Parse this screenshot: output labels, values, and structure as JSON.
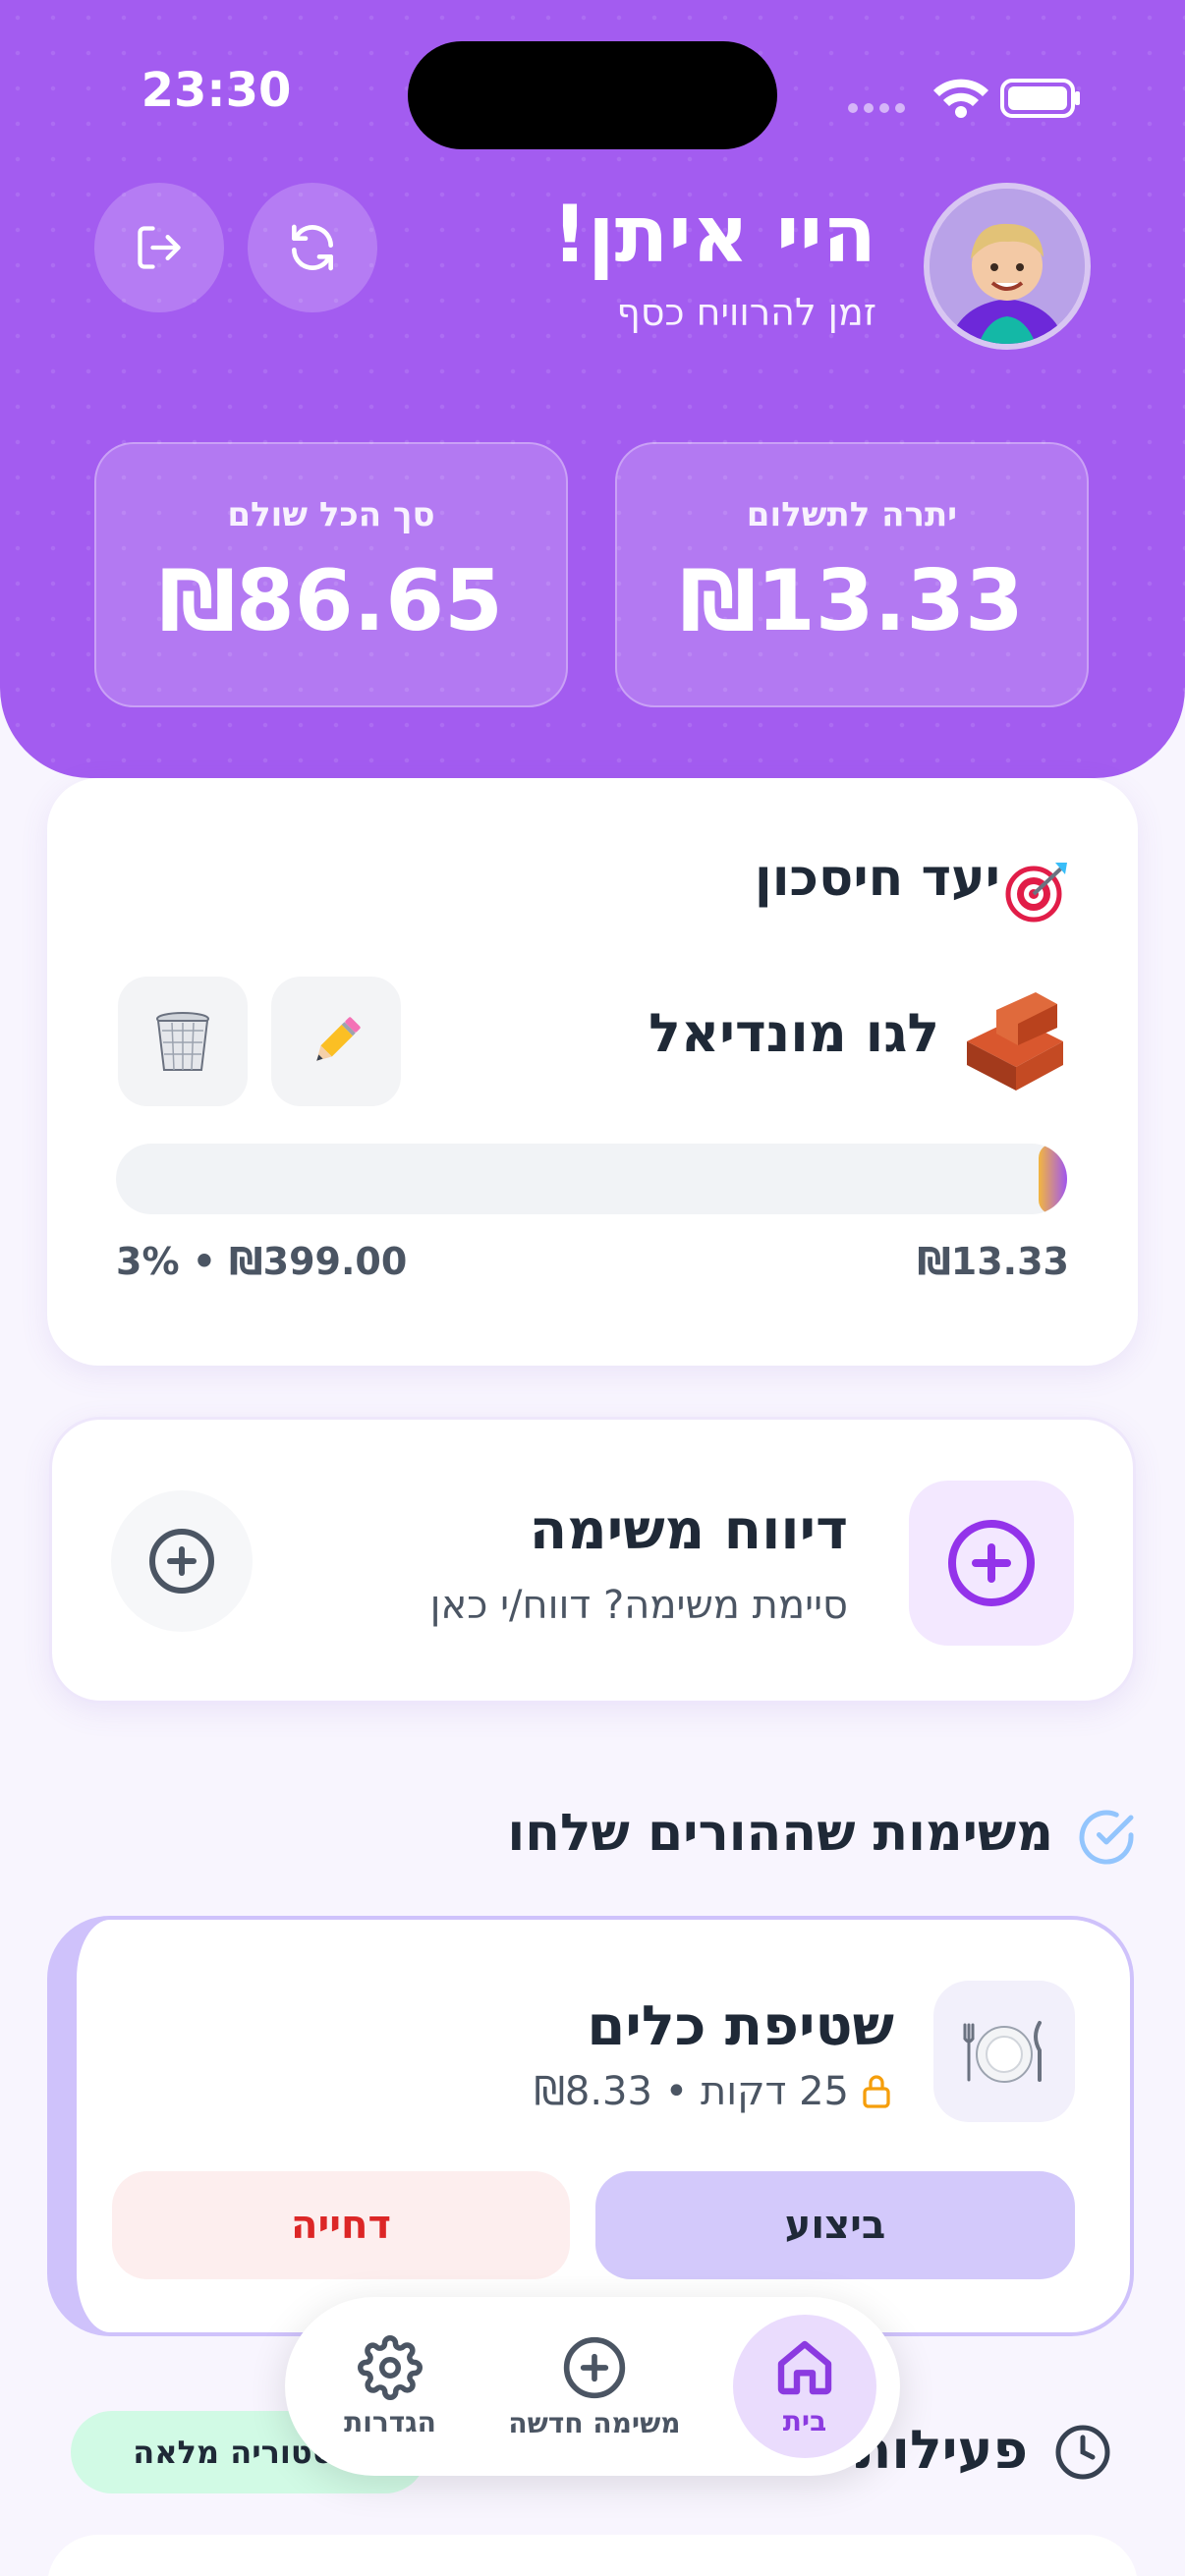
{
  "status_bar": {
    "time": "23:30"
  },
  "header": {
    "greeting": "היי איתן!",
    "subtitle": "זמן להרוויח כסף",
    "stats": [
      {
        "label": "יתרה לתשלום",
        "value": "₪13.33"
      },
      {
        "label": "סך הכל שולם",
        "value": "₪86.65"
      }
    ]
  },
  "savings_goal": {
    "title": "יעד חיסכון",
    "item_name": "לגו מונדיאל",
    "saved": "₪13.33",
    "target_summary": "3% • ₪399.00",
    "progress_percent": 3
  },
  "report_task": {
    "title": "דיווח משימה",
    "subtitle": "סיימת משימה? דווח/י כאן"
  },
  "parent_tasks": {
    "section_title": "משימות שההורים שלחו",
    "tasks": [
      {
        "title": "שטיפת כלים",
        "meta": "25 דקות • ₪8.33",
        "do_label": "ביצוע",
        "reject_label": "דחייה"
      }
    ]
  },
  "activity": {
    "title": "פעילות",
    "history_label": "היסטוריה מלאה"
  },
  "bottom_nav": {
    "items": [
      {
        "label": "בית"
      },
      {
        "label": "משימה חדשה"
      },
      {
        "label": "הגדרות"
      }
    ]
  },
  "colors": {
    "brand_purple": "#a35cf0",
    "accent_violet": "#8b3ae0",
    "reject_red": "#dc2626",
    "do_button_bg": "#d3c9fb"
  },
  "icons": [
    "logout-icon",
    "refresh-icon",
    "target-icon",
    "brick-icon",
    "pencil-icon",
    "trash-icon",
    "plus-circle-icon",
    "check-circle-icon",
    "plate-icon",
    "lock-icon",
    "clock-icon",
    "home-icon",
    "gear-icon"
  ]
}
